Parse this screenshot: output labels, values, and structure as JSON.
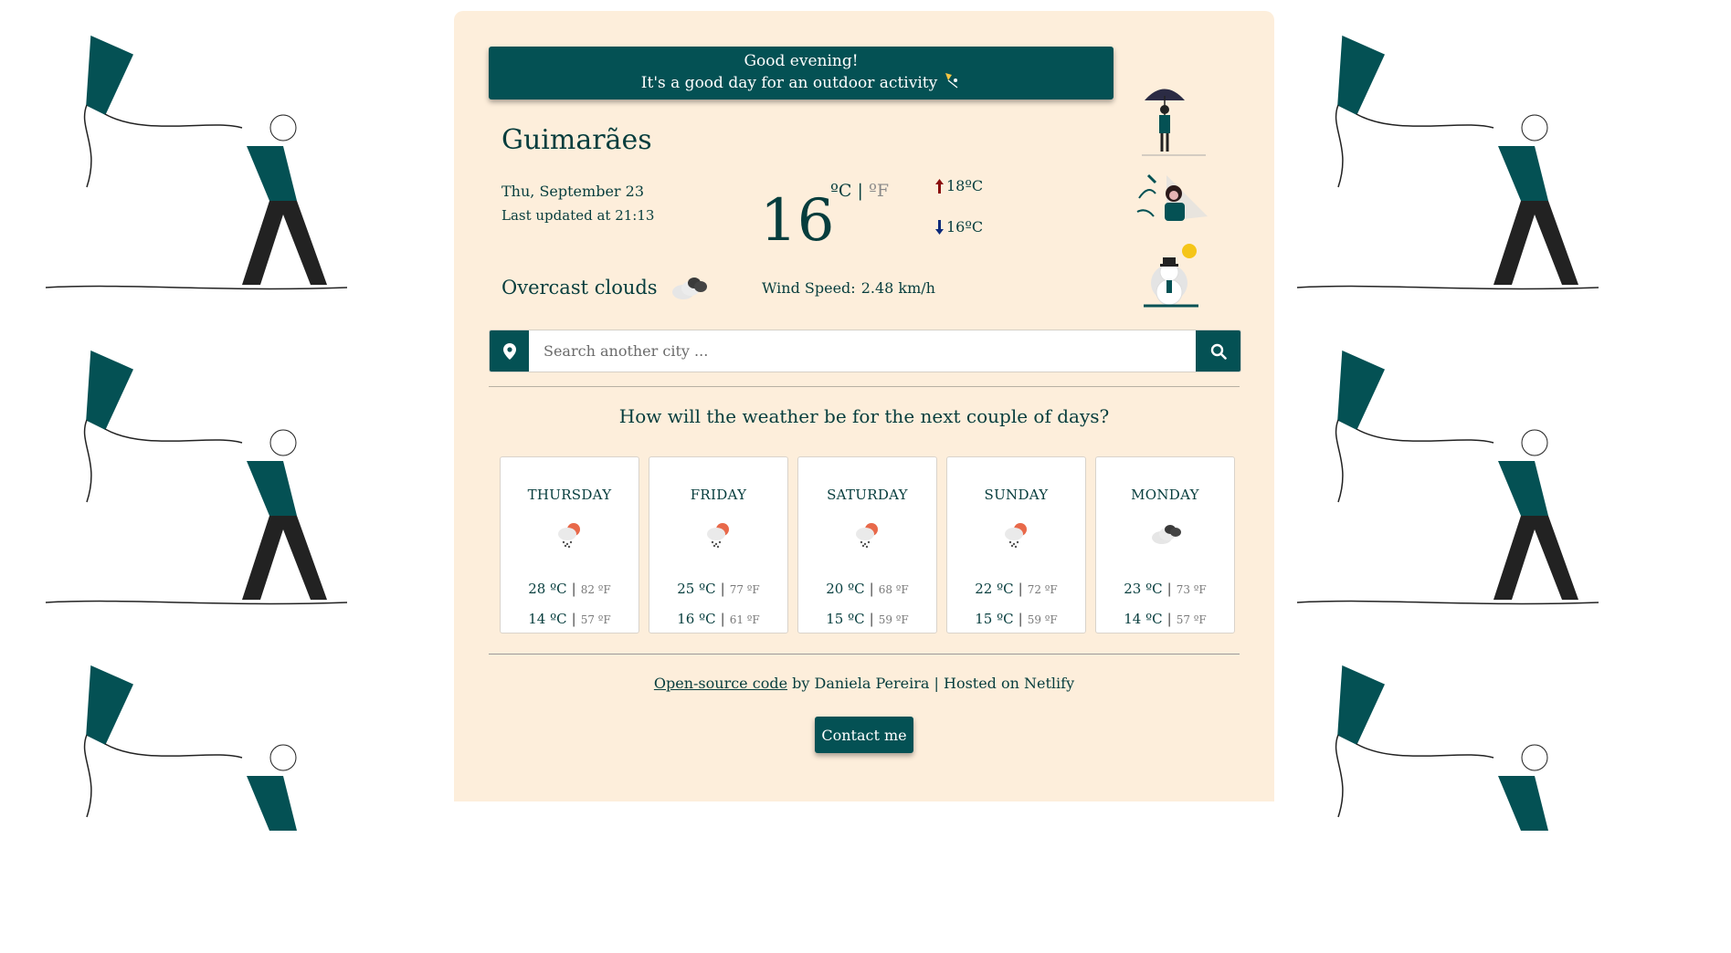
{
  "greeting": {
    "line1": "Good evening!",
    "line2": "It's a good day for an outdoor activity"
  },
  "current": {
    "city": "Guimarães",
    "date": "Thu, September 23",
    "last_updated": "Last updated at 21:13",
    "temperature": "16",
    "unit_c": "ºC",
    "unit_sep": "|",
    "unit_f": "ºF",
    "max": "18ºC",
    "min": "16ºC",
    "description": "Overcast clouds",
    "wind_label": "Wind Speed:",
    "wind_value": "2.48 km/h",
    "icon": "overcast-clouds-icon"
  },
  "search": {
    "placeholder": "Search another city ..."
  },
  "forecast": {
    "title": "How will the weather be for the next couple of days?",
    "days": [
      {
        "name": "THURSDAY",
        "icon": "rain-sun-icon",
        "max_c": "28 ºC",
        "max_f": "82 ºF",
        "min_c": "14 ºC",
        "min_f": "57 ºF"
      },
      {
        "name": "FRIDAY",
        "icon": "rain-sun-icon",
        "max_c": "25 ºC",
        "max_f": "77 ºF",
        "min_c": "16 ºC",
        "min_f": "61 ºF"
      },
      {
        "name": "SATURDAY",
        "icon": "rain-sun-icon",
        "max_c": "20 ºC",
        "max_f": "68 ºF",
        "min_c": "15 ºC",
        "min_f": "59 ºF"
      },
      {
        "name": "SUNDAY",
        "icon": "rain-sun-icon",
        "max_c": "22 ºC",
        "max_f": "72 ºF",
        "min_c": "15 ºC",
        "min_f": "59 ºF"
      },
      {
        "name": "MONDAY",
        "icon": "overcast-clouds-icon",
        "max_c": "23 ºC",
        "max_f": "73 ºF",
        "min_c": "14 ºC",
        "min_f": "57 ºF"
      }
    ]
  },
  "footer": {
    "link_text": "Open-source code",
    "rest_text": " by Daniela Pereira | Hosted on Netlify",
    "contact_label": "Contact me"
  },
  "colors": {
    "primary": "#045154",
    "card_bg": "#fdeedb",
    "text": "#063d3d",
    "sun": "#e8694a"
  }
}
